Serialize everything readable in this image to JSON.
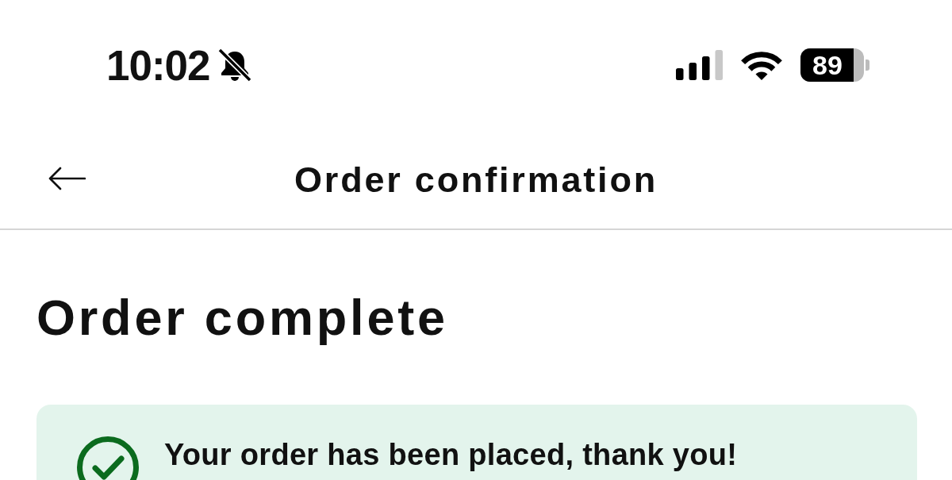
{
  "status_bar": {
    "time": "10:02",
    "battery": "89"
  },
  "header": {
    "title": "Order confirmation"
  },
  "page_title": "Order complete",
  "banner": {
    "message": "Your order has been placed, thank you!"
  }
}
